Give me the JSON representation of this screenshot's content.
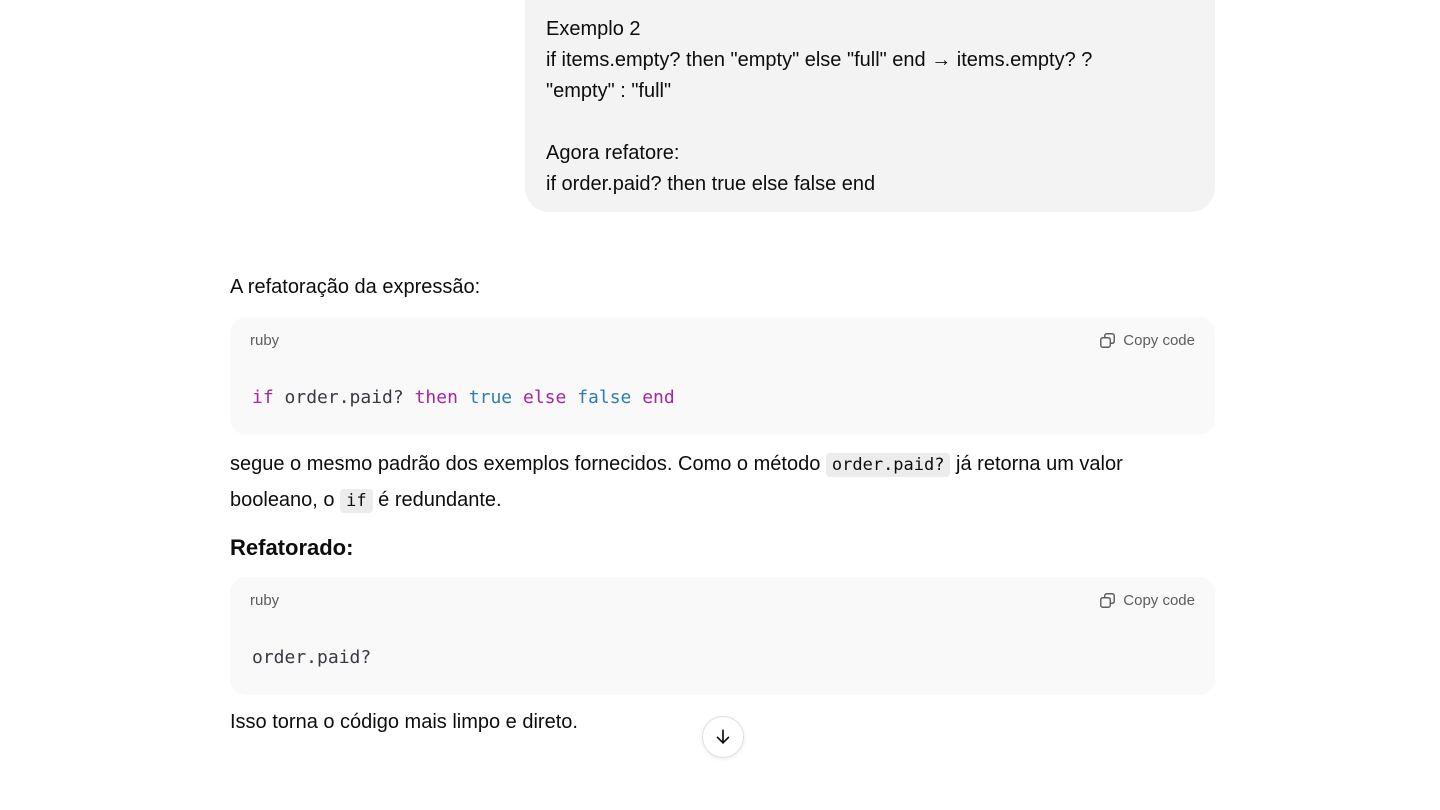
{
  "user_message": {
    "lines": [
      "Exemplo 2",
      "if items.empty? then \"empty\" else \"full\" end → items.empty? ?",
      "\"empty\" : \"full\"",
      "",
      "Agora refatore:",
      "if order.paid? then true else false end"
    ]
  },
  "assistant": {
    "intro": "A refatoração da expressão:",
    "code_block_1": {
      "language": "ruby",
      "copy_label": "Copy code",
      "tokens": [
        {
          "text": "if",
          "kind": "kw"
        },
        {
          "text": " order.paid? ",
          "kind": "plain"
        },
        {
          "text": "then",
          "kind": "kw"
        },
        {
          "text": " ",
          "kind": "plain"
        },
        {
          "text": "true",
          "kind": "lit"
        },
        {
          "text": " ",
          "kind": "plain"
        },
        {
          "text": "else",
          "kind": "kw"
        },
        {
          "text": " ",
          "kind": "plain"
        },
        {
          "text": "false",
          "kind": "lit"
        },
        {
          "text": " ",
          "kind": "plain"
        },
        {
          "text": "end",
          "kind": "kw"
        }
      ]
    },
    "explanation": {
      "part1": "segue o mesmo padrão dos exemplos fornecidos. Como o método ",
      "code1": "order.paid?",
      "part2": " já retorna um valor booleano, o ",
      "code2": "if",
      "part3": " é redundante."
    },
    "heading": "Refatorado:",
    "code_block_2": {
      "language": "ruby",
      "copy_label": "Copy code",
      "code": "order.paid?"
    },
    "closing": "Isso torna o código mais limpo e direto."
  },
  "icons": {
    "copy": "copy-icon",
    "scroll_down": "arrow-down-icon"
  },
  "colors": {
    "keyword": "#a626a4",
    "literal": "#2e7fb0",
    "bubble_bg": "#f3f3f3",
    "code_bg": "#f9f9f9"
  }
}
